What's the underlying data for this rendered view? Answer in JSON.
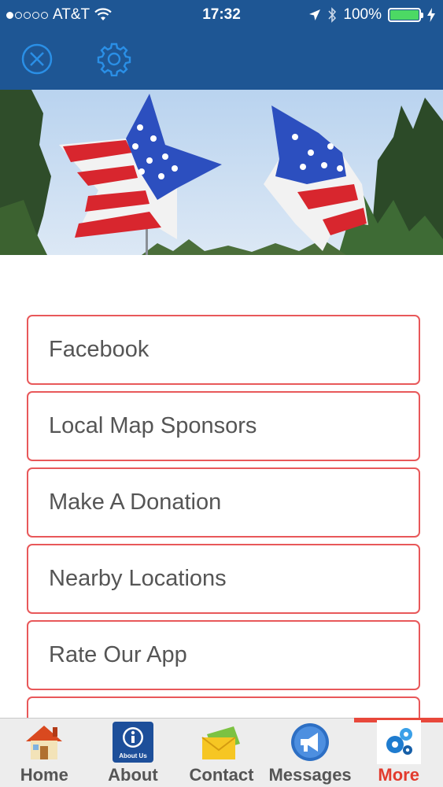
{
  "status_bar": {
    "carrier": "AT&T",
    "time": "17:32",
    "battery": "100%",
    "battery_level": 1.0,
    "signal_bars_filled": 1,
    "signal_bars_total": 5
  },
  "toolbar": {
    "close_icon": "close-circle-icon",
    "settings_icon": "gear-icon"
  },
  "banner": {
    "image": "american-flag-star-balloons"
  },
  "menu": {
    "items": [
      {
        "label": "Facebook"
      },
      {
        "label": "Local Map Sponsors"
      },
      {
        "label": "Make A Donation"
      },
      {
        "label": "Nearby Locations"
      },
      {
        "label": "Rate Our App"
      }
    ]
  },
  "tab_bar": {
    "tabs": [
      {
        "label": "Home",
        "icon": "house-icon"
      },
      {
        "label": "About",
        "icon": "about-us-info-icon",
        "icon_text": "About Us"
      },
      {
        "label": "Contact",
        "icon": "envelope-icon"
      },
      {
        "label": "Messages",
        "icon": "megaphone-icon"
      },
      {
        "label": "More",
        "icon": "gears-icon",
        "active": true
      }
    ]
  },
  "colors": {
    "header_blue": "#1e5694",
    "accent_red": "#e8483b",
    "item_border": "#e8585a",
    "item_text": "#555555"
  }
}
